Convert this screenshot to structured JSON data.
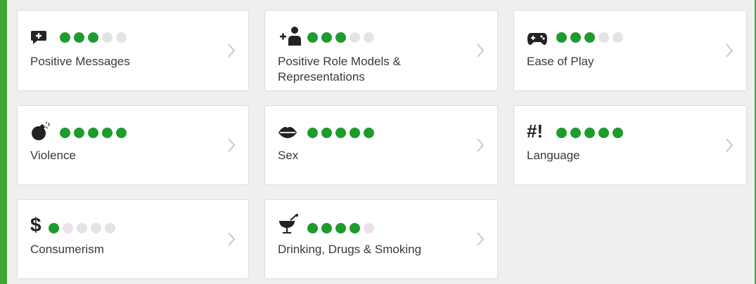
{
  "ratings": [
    {
      "key": "positive-messages",
      "label": "Positive Messages",
      "icon": "speech-bubble-plus-icon",
      "level": 3,
      "max": 5
    },
    {
      "key": "positive-role-models",
      "label": "Positive Role Models & Representations",
      "icon": "person-plus-icon",
      "level": 3,
      "max": 5
    },
    {
      "key": "ease-of-play",
      "label": "Ease of Play",
      "icon": "gamepad-icon",
      "level": 3,
      "max": 5
    },
    {
      "key": "violence",
      "label": "Violence",
      "icon": "bomb-icon",
      "level": 5,
      "max": 5
    },
    {
      "key": "sex",
      "label": "Sex",
      "icon": "lips-icon",
      "level": 5,
      "max": 5
    },
    {
      "key": "language",
      "label": "Language",
      "icon": "hash-exclamation-icon",
      "icon_text": "#!",
      "level": 5,
      "max": 5
    },
    {
      "key": "consumerism",
      "label": "Consumerism",
      "icon": "dollar-icon",
      "icon_text": "$",
      "level": 1,
      "max": 5
    },
    {
      "key": "drinking-drugs-smoking",
      "label": "Drinking, Drugs & Smoking",
      "icon": "cocktail-icon",
      "level": 4,
      "max": 5
    }
  ],
  "colors": {
    "frame": "#3fa535",
    "dot_on": "#1d9b2c",
    "dot_off": "#e4e4e4"
  }
}
